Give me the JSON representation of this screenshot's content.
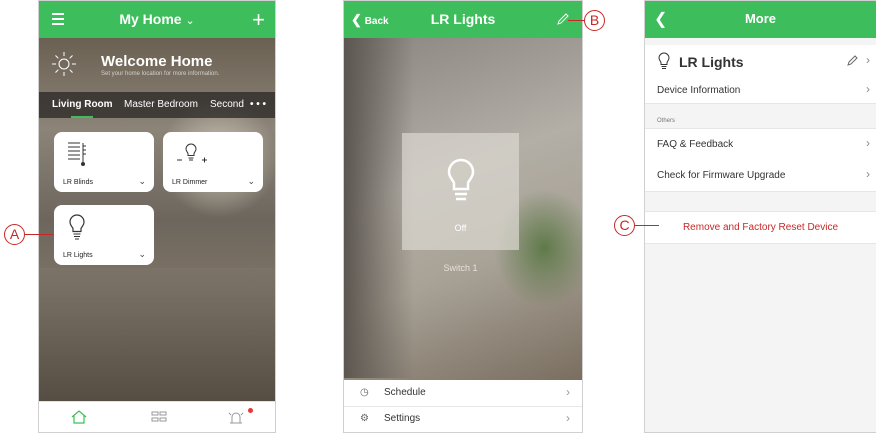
{
  "screen1": {
    "header_title": "My Home",
    "welcome_title": "Welcome Home",
    "welcome_subtitle": "Set your home location for more information.",
    "room_tabs": [
      "Living Room",
      "Master Bedroom",
      "Second"
    ],
    "more_tabs": "• • •",
    "devices": [
      {
        "label": "LR Blinds",
        "icon": "blinds-icon"
      },
      {
        "label": "LR Dimmer",
        "icon": "dimmer-bulb-icon"
      },
      {
        "label": "LR Lights",
        "icon": "light-bulb-icon"
      }
    ],
    "nav": [
      "home-icon",
      "grid-icon",
      "alarm-icon"
    ]
  },
  "screen2": {
    "back_label": "Back",
    "title": "LR Lights",
    "switch_state": "Off",
    "switch_name": "Switch 1",
    "menu": [
      {
        "label": "Schedule",
        "icon": "clock-icon"
      },
      {
        "label": "Settings",
        "icon": "gear-icon"
      }
    ]
  },
  "screen3": {
    "title": "More",
    "device_name": "LR Lights",
    "device_information": "Device Information",
    "section_others": "Others",
    "faq": "FAQ & Feedback",
    "firmware": "Check for Firmware Upgrade",
    "remove": "Remove and Factory Reset Device"
  },
  "callouts": {
    "a": "A",
    "b": "B",
    "c": "C"
  },
  "colors": {
    "accent": "#3dbd5b",
    "danger": "#c62828",
    "notification": "#e53935"
  }
}
